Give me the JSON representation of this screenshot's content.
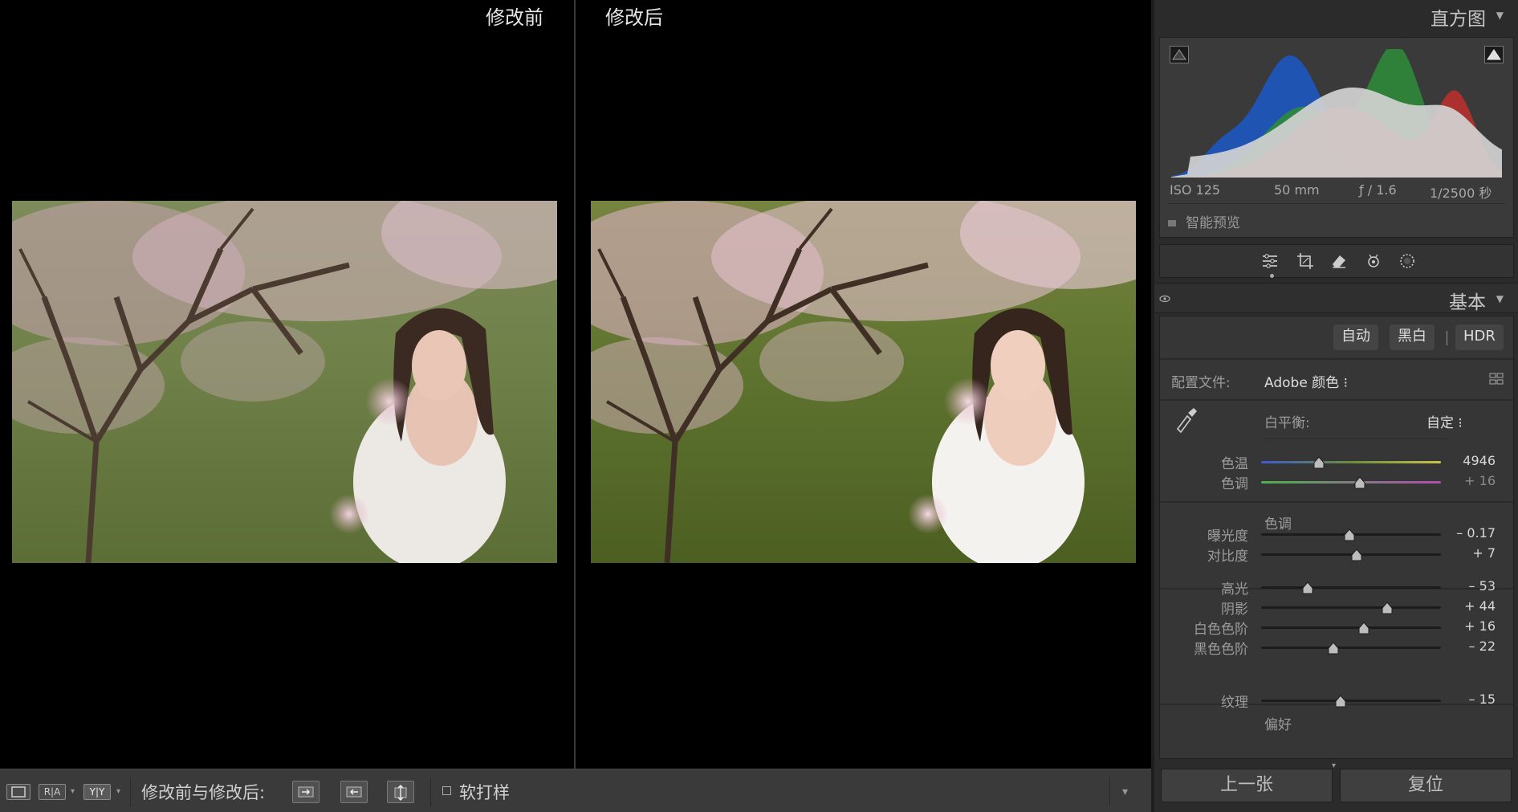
{
  "compare": {
    "before_label": "修改前",
    "after_label": "修改后"
  },
  "toolbar": {
    "view_loupe_icon": "single-view-icon",
    "view_ra_label": "R|A",
    "view_yy_label": "Y|Y",
    "compare_label": "修改前与修改后:",
    "soft_proof_label": "软打样",
    "soft_proof_checked": false
  },
  "histogram": {
    "title": "直方图",
    "iso": "ISO 125",
    "focal": "50 mm",
    "aperture": "ƒ / 1.6",
    "shutter": "1/2500 秒",
    "smart_preview": "智能预览"
  },
  "tools": [
    "edit-sliders-icon",
    "crop-icon",
    "heal-eraser-icon",
    "red-eye-icon",
    "mask-icon"
  ],
  "basic": {
    "title": "基本",
    "auto": "自动",
    "bw": "黑白",
    "hdr": "HDR",
    "profile_label": "配置文件:",
    "profile_value": "Adobe 颜色 ⁝",
    "wb_label": "白平衡:",
    "wb_value": "自定 ⁝",
    "tone_section": "色调",
    "presence_section": "偏好",
    "sliders": [
      {
        "key": "temp",
        "label": "色温",
        "value": "4946",
        "pos": 0.32,
        "style": "temp",
        "dim": false
      },
      {
        "key": "tint",
        "label": "色调",
        "value": "+ 16",
        "pos": 0.55,
        "style": "tint",
        "dim": true
      },
      {
        "key": "exposure",
        "label": "曝光度",
        "value": "– 0.17",
        "pos": 0.49,
        "style": "plain",
        "dim": false
      },
      {
        "key": "contrast",
        "label": "对比度",
        "value": "+ 7",
        "pos": 0.53,
        "style": "plain",
        "dim": false
      },
      {
        "key": "highlights",
        "label": "高光",
        "value": "– 53",
        "pos": 0.26,
        "style": "plain",
        "dim": false
      },
      {
        "key": "shadows",
        "label": "阴影",
        "value": "+ 44",
        "pos": 0.7,
        "style": "plain",
        "dim": false
      },
      {
        "key": "whites",
        "label": "白色色阶",
        "value": "+ 16",
        "pos": 0.57,
        "style": "plain",
        "dim": false
      },
      {
        "key": "blacks",
        "label": "黑色色阶",
        "value": "– 22",
        "pos": 0.4,
        "style": "plain",
        "dim": false
      },
      {
        "key": "texture",
        "label": "纹理",
        "value": "– 15",
        "pos": 0.44,
        "style": "plain",
        "dim": false
      }
    ]
  },
  "nav": {
    "prev": "上一张",
    "reset": "复位"
  },
  "colors": {
    "panel_bg": "#2b2b2b",
    "panel_body": "#363636",
    "toolbar_bg": "#3a3a3a",
    "hist_red": "#c0302e",
    "hist_green": "#2f8a3b",
    "hist_blue": "#1f55b8",
    "hist_luma": "#d2d2d2"
  }
}
